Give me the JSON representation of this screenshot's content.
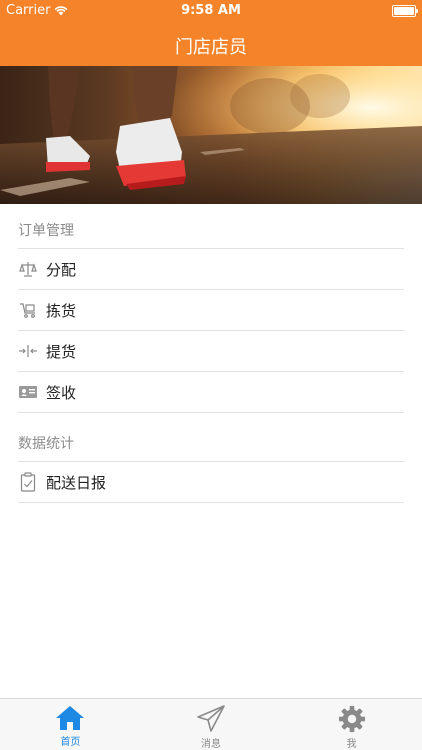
{
  "status_bar": {
    "carrier": "Carrier",
    "time": "9:58 AM"
  },
  "nav": {
    "title": "门店店员"
  },
  "sections": [
    {
      "header": "订单管理",
      "items": [
        {
          "label": "分配",
          "icon": "scale-icon"
        },
        {
          "label": "拣货",
          "icon": "cart-icon"
        },
        {
          "label": "提货",
          "icon": "split-arrows-icon"
        },
        {
          "label": "签收",
          "icon": "id-card-icon"
        }
      ]
    },
    {
      "header": "数据统计",
      "items": [
        {
          "label": "配送日报",
          "icon": "clipboard-icon"
        }
      ]
    }
  ],
  "tabbar": {
    "tabs": [
      {
        "label": "首页",
        "icon": "home-icon",
        "active": true
      },
      {
        "label": "消息",
        "icon": "paper-plane-icon",
        "active": false
      },
      {
        "label": "我",
        "icon": "gear-icon",
        "active": false
      }
    ]
  },
  "colors": {
    "accent": "#f5832a",
    "tab_active": "#1e88e5",
    "tab_inactive": "#8a8a8a"
  }
}
